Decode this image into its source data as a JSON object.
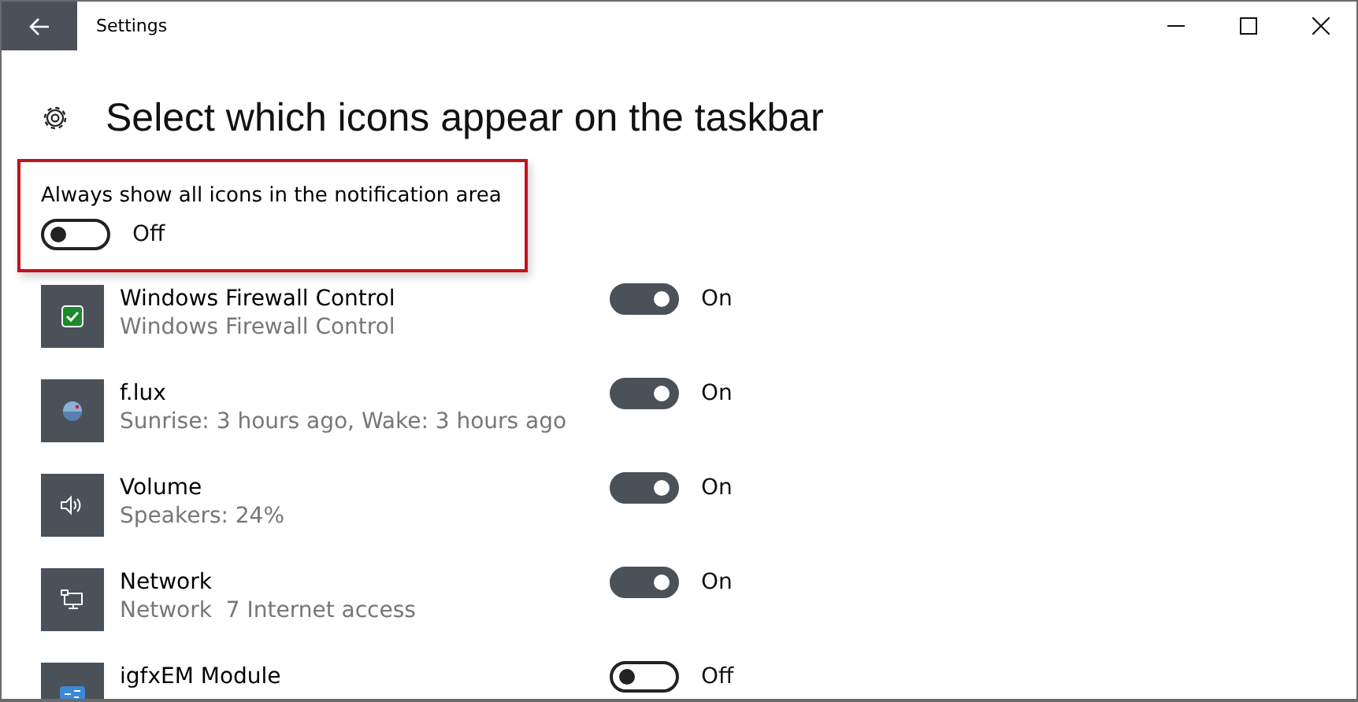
{
  "window": {
    "title": "Settings"
  },
  "heading": "Select which icons appear on the taskbar",
  "master": {
    "label": "Always show all icons in the notification area",
    "on": false,
    "state_label": "Off"
  },
  "items": [
    {
      "kind": "firewall",
      "name": "Windows Firewall Control",
      "detail": "Windows Firewall Control",
      "on": true,
      "state_label": "On"
    },
    {
      "kind": "globe",
      "name": "f.lux",
      "detail": "Sunrise: 3 hours ago, Wake: 3 hours ago",
      "on": true,
      "state_label": "On"
    },
    {
      "kind": "speaker",
      "name": "Volume",
      "detail": "Speakers: 24%",
      "on": true,
      "state_label": "On"
    },
    {
      "kind": "monitor",
      "name": "Network",
      "detail": "Network  7 Internet access",
      "on": true,
      "state_label": "On"
    },
    {
      "kind": "module",
      "name": "igfxEM Module",
      "on": false,
      "state_label": "Off"
    }
  ]
}
